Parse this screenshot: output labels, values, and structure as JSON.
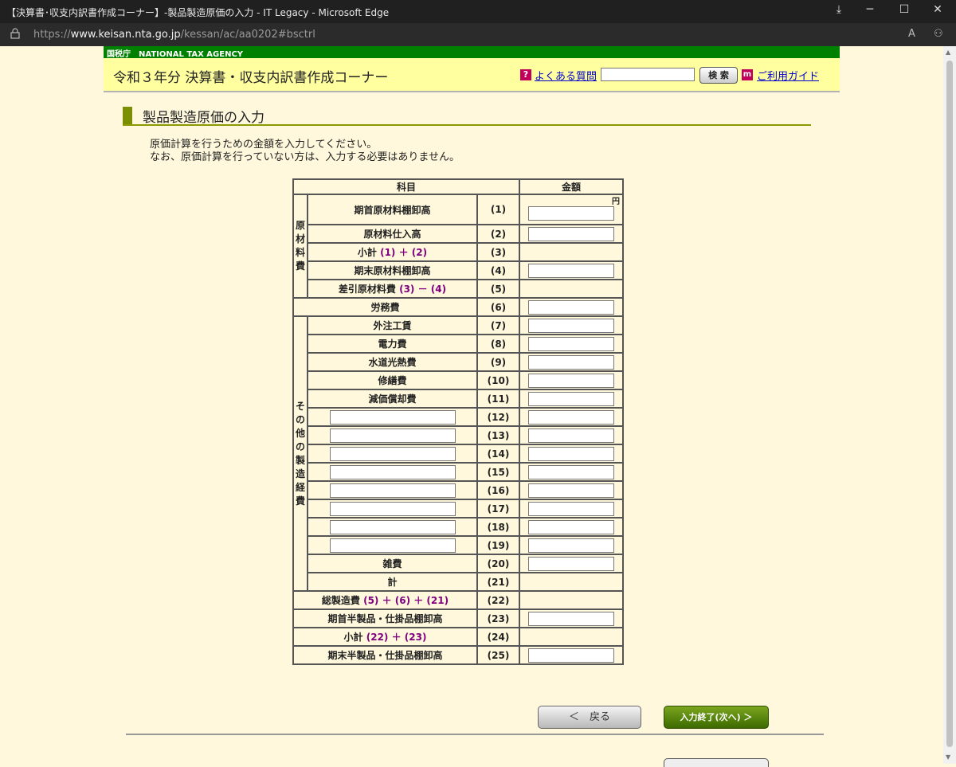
{
  "browser": {
    "title": "【決算書･収支内訳書作成コーナー】-製品製造原価の入力 - IT Legacy - Microsoft Edge",
    "url_scheme": "https://",
    "url_host": "www.keisan.nta.go.jp",
    "url_path": "/kessan/ac/aa0202#bsctrl"
  },
  "header": {
    "agency": "国税庁　NATIONAL TAX AGENCY",
    "site_title": "令和３年分 決算書・収支内訳書作成コーナー",
    "faq_icon": "?",
    "faq_link": "よくある質問",
    "search_button": "検 索",
    "guide_icon": "m",
    "guide_link": "ご利用ガイド"
  },
  "page": {
    "heading": "製品製造原価の入力",
    "intro_line1": "原価計算を行うための金額を入力してください。",
    "intro_line2": "なお、原価計算を行っていない方は、入力する必要はありません。"
  },
  "table": {
    "col_item": "科目",
    "col_amount": "金額",
    "yen": "円",
    "group_raw": "原材料費",
    "group_other": "その他の製造経費",
    "rows": {
      "r1": {
        "label": "期首原材料棚卸高",
        "num": "(1)"
      },
      "r2": {
        "label": "原材料仕入高",
        "num": "(2)"
      },
      "r3": {
        "label": "小計",
        "calc": "(1) ＋ (2)",
        "num": "(3)"
      },
      "r4": {
        "label": "期末原材料棚卸高",
        "num": "(4)"
      },
      "r5": {
        "label": "差引原材料費",
        "calc": "(3) － (4)",
        "num": "(5)"
      },
      "r6": {
        "label": "労務費",
        "num": "(6)"
      },
      "r7": {
        "label": "外注工賃",
        "num": "(7)"
      },
      "r8": {
        "label": "電力費",
        "num": "(8)"
      },
      "r9": {
        "label": "水道光熱費",
        "num": "(9)"
      },
      "r10": {
        "label": "修繕費",
        "num": "(10)"
      },
      "r11": {
        "label": "減価償却費",
        "num": "(11)"
      },
      "r12": {
        "num": "(12)"
      },
      "r13": {
        "num": "(13)"
      },
      "r14": {
        "num": "(14)"
      },
      "r15": {
        "num": "(15)"
      },
      "r16": {
        "num": "(16)"
      },
      "r17": {
        "num": "(17)"
      },
      "r18": {
        "num": "(18)"
      },
      "r19": {
        "num": "(19)"
      },
      "r20": {
        "label": "雑費",
        "num": "(20)"
      },
      "r21": {
        "label": "計",
        "num": "(21)"
      },
      "r22": {
        "label": "総製造費",
        "calc": "(5) ＋ (6) ＋ (21)",
        "num": "(22)"
      },
      "r23": {
        "label": "期首半製品・仕掛品棚卸高",
        "num": "(23)"
      },
      "r24": {
        "label": "小計",
        "calc": "(22) ＋ (23)",
        "num": "(24)"
      },
      "r25": {
        "label": "期末半製品・仕掛品棚卸高",
        "num": "(25)"
      }
    }
  },
  "buttons": {
    "back": "＜　戻る",
    "next": "入力終了(次へ) ＞"
  }
}
